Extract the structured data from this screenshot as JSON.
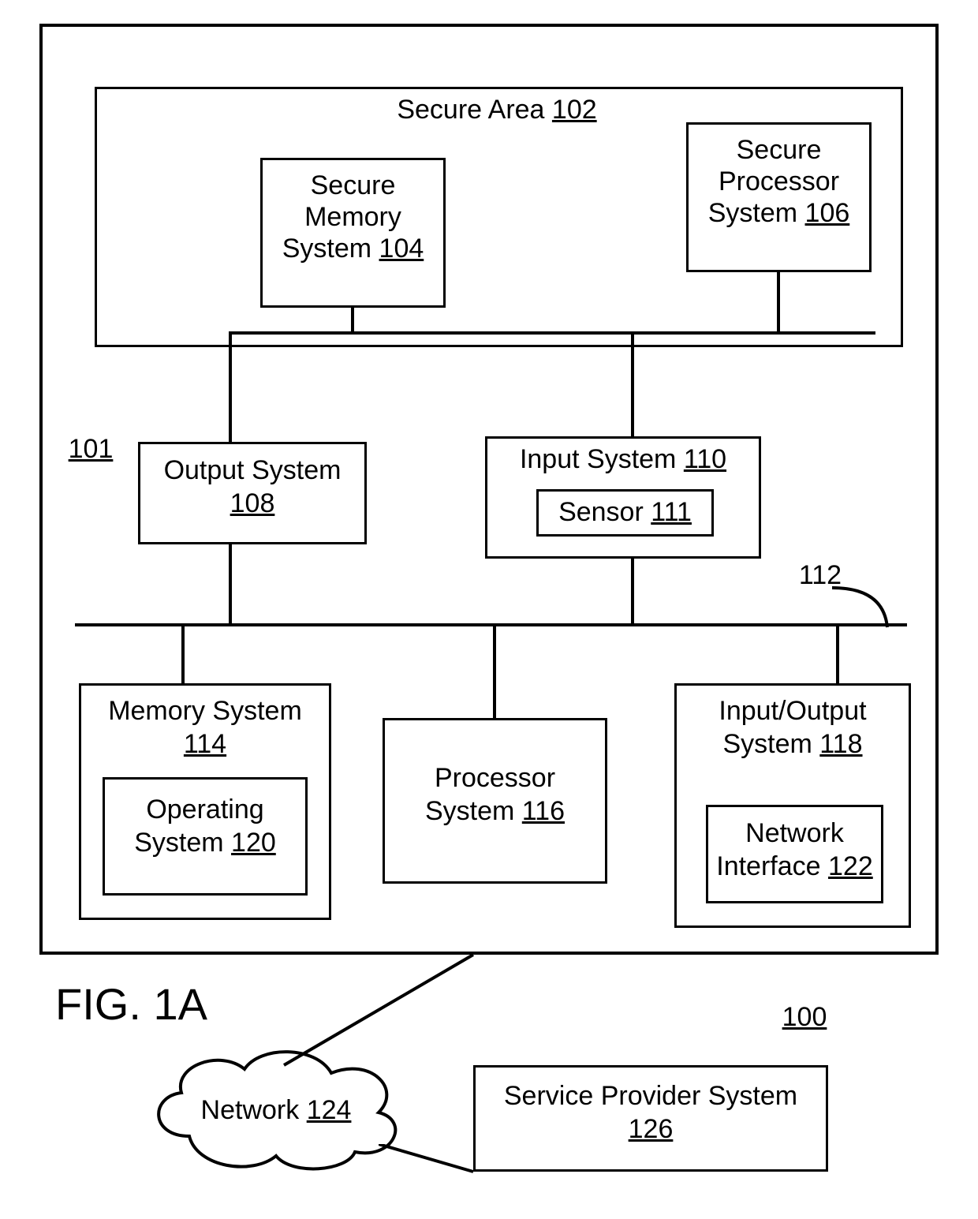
{
  "figure": {
    "caption": "FIG. 1A",
    "ref_overall": "100",
    "ref_device": "101",
    "ref_bus": "112"
  },
  "secure_area": {
    "title": "Secure Area",
    "num": "102"
  },
  "secure_memory": {
    "l1": "Secure",
    "l2": "Memory",
    "l3": "System",
    "num": "104"
  },
  "secure_processor": {
    "l1": "Secure",
    "l2": "Processor",
    "l3": "System",
    "num": "106"
  },
  "output_system": {
    "l1": "Output System",
    "num": "108"
  },
  "input_system": {
    "l1": "Input System",
    "num": "110"
  },
  "sensor": {
    "l1": "Sensor",
    "num": "111"
  },
  "memory_system": {
    "l1": "Memory System",
    "num": "114"
  },
  "operating_system": {
    "l1": "Operating",
    "l2": "System",
    "num": "120"
  },
  "processor_system": {
    "l1": "Processor",
    "l2": "System",
    "num": "116"
  },
  "io_system": {
    "l1": "Input/Output",
    "l2": "System",
    "num": "118"
  },
  "network_interface": {
    "l1": "Network",
    "l2": "Interface",
    "num": "122"
  },
  "network": {
    "l1": "Network",
    "num": "124"
  },
  "service_provider": {
    "l1": "Service Provider System",
    "num": "126"
  }
}
